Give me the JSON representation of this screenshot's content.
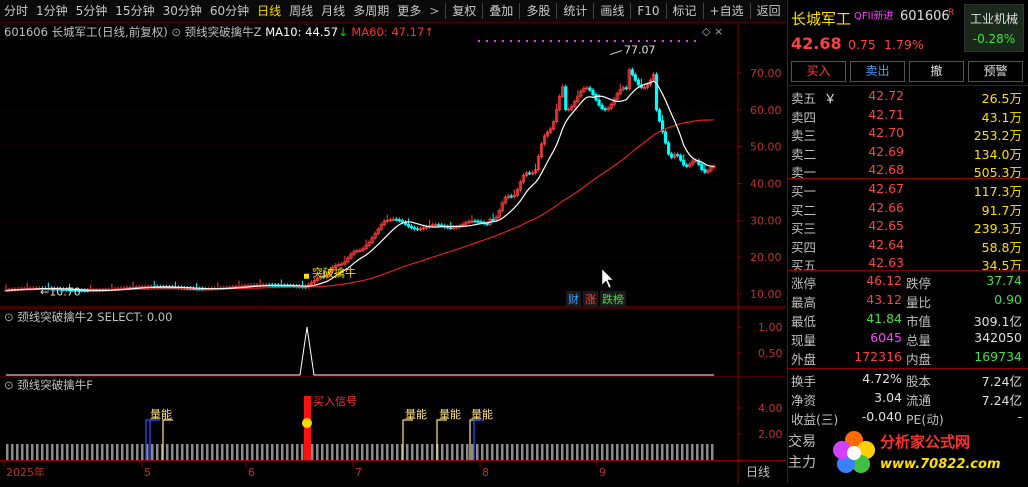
{
  "toolbar": {
    "periods": [
      "分时",
      "1分钟",
      "5分钟",
      "15分钟",
      "30分钟",
      "60分钟",
      "日线",
      "周线",
      "月线",
      "多周期",
      "更多"
    ],
    "active_period": "日线",
    "more_arrow": ">",
    "tools": [
      "复权",
      "叠加",
      "多股",
      "统计",
      "画线",
      "F10",
      "标记",
      "+自选",
      "返回"
    ]
  },
  "main_legend": {
    "code": "601606",
    "name": "长城军工(日线,前复权)",
    "indicator": "颈线突破擒牛Z",
    "ma10_label": "MA10: 44.57",
    "ma10_arrow": "↓",
    "ma60_label": "MA60: 47.17",
    "ma60_arrow": "↑"
  },
  "main_chart": {
    "price_ticks": [
      "70.00",
      "60.00",
      "50.00",
      "40.00",
      "30.00",
      "20.00",
      "10.00"
    ],
    "high_label": "77.07",
    "low_label": "10.70",
    "signal_label": "突破擒牛",
    "badges": [
      {
        "text": "财",
        "color": "#3aa0ff"
      },
      {
        "text": "涨",
        "color": "#ff4040"
      },
      {
        "text": "跌榜",
        "color": "#40e040"
      }
    ]
  },
  "ind1": {
    "legend": "颈线突破擒牛2  SELECT: 0.00",
    "ticks": [
      "1.00",
      "0.50"
    ]
  },
  "ind2": {
    "legend": "颈线突破擒牛F",
    "ticks": [
      "4.00",
      "2.00"
    ],
    "labels": [
      "量能",
      "量能",
      "量能",
      "量能",
      "买入信号"
    ]
  },
  "date_axis": {
    "labels": [
      "2025年",
      "5",
      "6",
      "7",
      "8",
      "9"
    ],
    "period": "日线"
  },
  "quote": {
    "name": "长城军工",
    "tags": "QFII新进",
    "code": "601606",
    "r_badge": "R",
    "industry": "工业机械",
    "industry_change": "-0.28%",
    "price": "42.68",
    "change": "0.75",
    "change_pct": "1.79%",
    "buttons": [
      "买入",
      "卖出",
      "撤",
      "预警"
    ],
    "asks": [
      {
        "label": "卖五",
        "flag": "￥",
        "price": "42.72",
        "vol": "26.5万"
      },
      {
        "label": "卖四",
        "flag": "",
        "price": "42.71",
        "vol": "43.1万"
      },
      {
        "label": "卖三",
        "flag": "",
        "price": "42.70",
        "vol": "253.2万"
      },
      {
        "label": "卖二",
        "flag": "",
        "price": "42.69",
        "vol": "134.0万"
      },
      {
        "label": "卖一",
        "flag": "",
        "price": "42.68",
        "vol": "505.3万"
      }
    ],
    "bids": [
      {
        "label": "买一",
        "price": "42.67",
        "vol": "117.3万"
      },
      {
        "label": "买二",
        "price": "42.66",
        "vol": "91.7万"
      },
      {
        "label": "买三",
        "price": "42.65",
        "vol": "239.3万"
      },
      {
        "label": "买四",
        "price": "42.64",
        "vol": "58.8万"
      },
      {
        "label": "买五",
        "price": "42.63",
        "vol": "34.5万"
      }
    ],
    "stats": [
      {
        "l1": "涨停",
        "v1": "46.12",
        "c1": "red",
        "l2": "跌停",
        "v2": "37.74",
        "c2": "green"
      },
      {
        "l1": "最高",
        "v1": "43.12",
        "c1": "red",
        "l2": "量比",
        "v2": "0.90",
        "c2": "green"
      },
      {
        "l1": "最低",
        "v1": "41.84",
        "c1": "green",
        "l2": "市值",
        "v2": "309.1亿",
        "c2": "white"
      },
      {
        "l1": "现量",
        "v1": "6045",
        "c1": "magenta",
        "l2": "总量",
        "v2": "342050",
        "c2": "white"
      },
      {
        "l1": "外盘",
        "v1": "172316",
        "c1": "red",
        "l2": "内盘",
        "v2": "169734",
        "c2": "green"
      }
    ],
    "stats2": [
      {
        "l1": "换手",
        "v1": "4.72%",
        "l2": "股本",
        "v2": "7.24亿"
      },
      {
        "l1": "净资",
        "v1": "3.04",
        "l2": "流通",
        "v2": "7.24亿"
      },
      {
        "l1": "收益(三)",
        "v1": "-0.040",
        "l2": "PE(动)",
        "v2": "-"
      }
    ],
    "bottom_rows": [
      "交易",
      "主力"
    ],
    "watermark_title": "分析家公式网",
    "watermark_url": "www.70822.com"
  },
  "colors": {
    "up": "#ff4040",
    "down": "#00ffff",
    "ma10": "#ffffff",
    "ma60": "#e02020",
    "accent": "#ffd700"
  }
}
